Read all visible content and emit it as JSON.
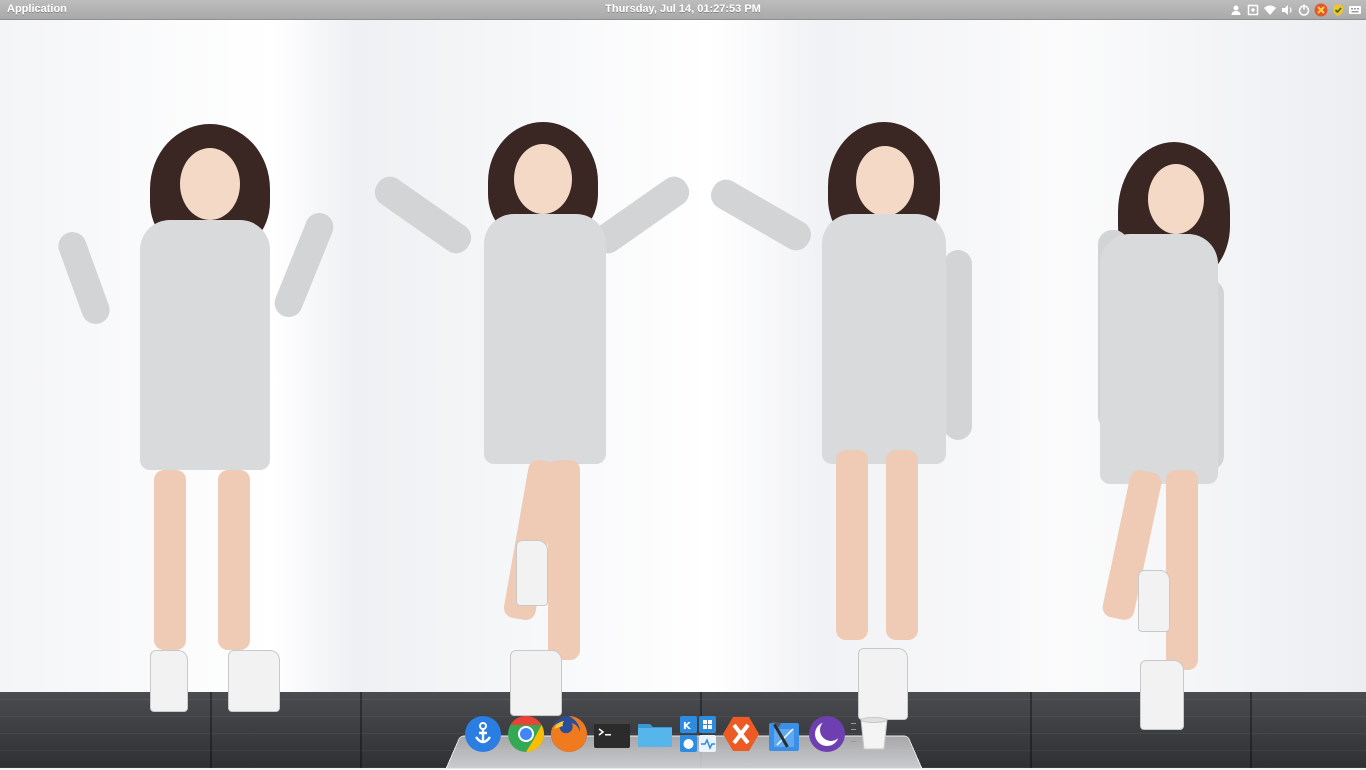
{
  "panel": {
    "app_menu": "Application",
    "clock": "Thursday, Jul 14, 01:27:53 PM",
    "tray_icons": [
      "user-icon",
      "screenshot-icon",
      "wifi-icon",
      "volume-icon",
      "power-icon",
      "crossover-tray-icon",
      "check-shield-icon",
      "keyboard-icon"
    ]
  },
  "dock": {
    "items": [
      {
        "name": "anchor-app-icon",
        "color": "#2a7de1"
      },
      {
        "name": "chrome-icon",
        "color": "#34a853"
      },
      {
        "name": "firefox-icon",
        "color": "#e66000"
      },
      {
        "name": "terminal-icon",
        "color": "#2b2b2b"
      },
      {
        "name": "files-icon",
        "color": "#4fb3e8"
      },
      {
        "name": "multi-os-icon",
        "color": "#2d8ce0"
      },
      {
        "name": "crossover-icon",
        "color": "#ee5a24"
      },
      {
        "name": "xcode-icon",
        "color": "#3b8fe6"
      },
      {
        "name": "night-mode-icon",
        "color": "#6d3fb0"
      },
      {
        "name": "trash-icon",
        "color": "#e8e8e8"
      }
    ]
  },
  "colors": {
    "panel_bg": "#b1b1b1",
    "floor": "#3a3b3e",
    "wall": "#f6f7f9"
  }
}
